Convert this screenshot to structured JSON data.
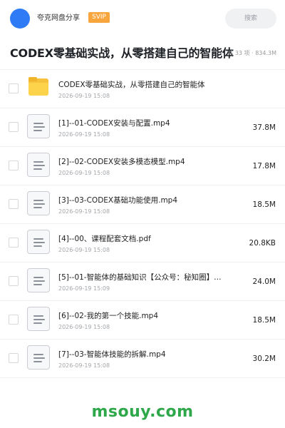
{
  "header": {
    "share_name": "夸克网盘分享",
    "badge": "SVIP",
    "search_placeholder": "搜索",
    "avatar_color": "#2f7bf5",
    "badge_color": "#f7a53c"
  },
  "title_row": {
    "title": "CODEX零基础实战，从零搭建自己的智能体",
    "meta": "共 33 项 · 834.3M"
  },
  "files": [
    {
      "type": "folder",
      "icon": "folder-icon",
      "name": "CODEX零基础实战，从零搭建自己的智能体",
      "date": "2026-09-19 15:08",
      "size": ""
    },
    {
      "type": "file",
      "icon": "document-icon",
      "name": "[1]--01-CODEX安装与配置.mp4",
      "date": "2026-09-19 15:08",
      "size": "37.8M"
    },
    {
      "type": "file",
      "icon": "document-icon",
      "name": "[2]--02-CODEX安装多模态模型.mp4",
      "date": "2026-09-19 15:08",
      "size": "17.8M"
    },
    {
      "type": "file",
      "icon": "document-icon",
      "name": "[3]--03-CODEX基础功能使用.mp4",
      "date": "2026-09-19 15:08",
      "size": "18.5M"
    },
    {
      "type": "file",
      "icon": "document-icon",
      "name": "[4]--00、课程配套文档.pdf",
      "date": "2026-09-19 15:08",
      "size": "20.8KB"
    },
    {
      "type": "file",
      "icon": "document-icon",
      "name": "[5]--01-智能体的基础知识【公众号：秘知圈】…",
      "date": "2026-09-19 15:09",
      "size": "24.0M"
    },
    {
      "type": "file",
      "icon": "document-icon",
      "name": "[6]--02-我的第一个技能.mp4",
      "date": "2026-09-19 15:08",
      "size": "18.5M"
    },
    {
      "type": "file",
      "icon": "document-icon",
      "name": "[7]--03-智能体技能的拆解.mp4",
      "date": "2026-09-19 15:08",
      "size": "30.2M"
    }
  ],
  "watermark": {
    "text": "msouy.com",
    "color": "#2ea84a"
  }
}
